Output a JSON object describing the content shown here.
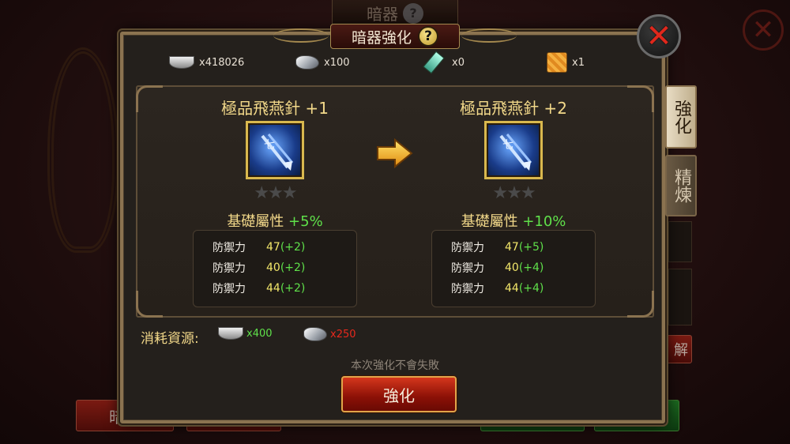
{
  "background": {
    "title": "暗器",
    "bottom_left_button": "暗器",
    "side_button": "解"
  },
  "dialog": {
    "title": "暗器強化",
    "resources": [
      {
        "icon": "silver-ingot-icon",
        "count": "x418026"
      },
      {
        "icon": "ore-icon",
        "count": "x100"
      },
      {
        "icon": "gem-icon",
        "count": "x0"
      },
      {
        "icon": "treasure-box-icon",
        "count": "x1"
      }
    ],
    "current": {
      "name": "極品飛燕針 +1",
      "stars": "★★★",
      "base_label": "基礎屬性",
      "base_bonus": "+5%",
      "stats": [
        {
          "label": "防禦力",
          "value": "47",
          "bonus": "(+2)"
        },
        {
          "label": "防禦力",
          "value": "40",
          "bonus": "(+2)"
        },
        {
          "label": "防禦力",
          "value": "44",
          "bonus": "(+2)"
        }
      ]
    },
    "next": {
      "name": "極品飛燕針 +2",
      "stars": "★★★",
      "base_label": "基礎屬性",
      "base_bonus": "+10%",
      "stats": [
        {
          "label": "防禦力",
          "value": "47",
          "bonus": "(+5)"
        },
        {
          "label": "防禦力",
          "value": "40",
          "bonus": "(+4)"
        },
        {
          "label": "防禦力",
          "value": "44",
          "bonus": "(+4)"
        }
      ]
    },
    "tabs": {
      "enhance": "強化",
      "refine": "精煉"
    },
    "cost": {
      "label": "消耗資源:",
      "silver": "x400",
      "ore": "x250"
    },
    "note": "本次強化不會失敗",
    "button": "強化"
  },
  "colors": {
    "accent_gold": "#f3d98a",
    "bonus_green": "#5fe04a",
    "insufficient_red": "#e8281c"
  }
}
